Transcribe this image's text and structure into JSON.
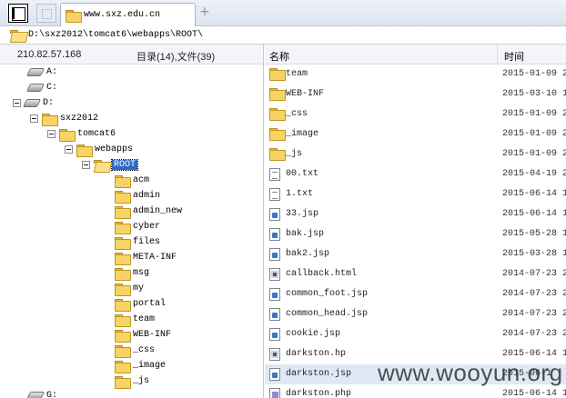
{
  "tabbar": {
    "tab_title": "www.sxz.edu.cn",
    "new_tab": "+"
  },
  "address": {
    "path": "D:\\sxz2012\\tomcat6\\webapps\\ROOT\\"
  },
  "left_header": {
    "ip": "210.82.57.168",
    "summary": "目录(14),文件(39)"
  },
  "tree": {
    "drive_a": "A:",
    "drive_c": "C:",
    "drive_d": "D:",
    "sxz2012": "sxz2012",
    "tomcat6": "tomcat6",
    "webapps": "webapps",
    "root": "ROOT",
    "children": [
      "acm",
      "admin",
      "admin_new",
      "cyber",
      "files",
      "META-INF",
      "msg",
      "my",
      "portal",
      "team",
      "WEB-INF",
      "_css",
      "_image",
      "_js"
    ],
    "drive_g": "G:"
  },
  "list_header": {
    "name": "名称",
    "time": "时间"
  },
  "files": [
    {
      "name": "team",
      "time": "2015-01-09 2",
      "icon": "folder-icon"
    },
    {
      "name": "WEB-INF",
      "time": "2015-03-10 1",
      "icon": "folder-icon"
    },
    {
      "name": "_css",
      "time": "2015-01-09 2",
      "icon": "folder-icon"
    },
    {
      "name": "_image",
      "time": "2015-01-09 2",
      "icon": "folder-icon"
    },
    {
      "name": "_js",
      "time": "2015-01-09 2",
      "icon": "folder-icon"
    },
    {
      "name": "00.txt",
      "time": "2015-04-19 2",
      "icon": "text-file-icon"
    },
    {
      "name": "1.txt",
      "time": "2015-06-14 1",
      "icon": "text-file-icon"
    },
    {
      "name": "33.jsp",
      "time": "2015-06-14 1",
      "icon": "jsp-file-icon"
    },
    {
      "name": "bak.jsp",
      "time": "2015-05-28 1",
      "icon": "jsp-file-icon"
    },
    {
      "name": "bak2.jsp",
      "time": "2015-03-28 1",
      "icon": "jsp-file-icon"
    },
    {
      "name": "callback.html",
      "time": "2014-07-23 2",
      "icon": "html-file-icon"
    },
    {
      "name": "common_foot.jsp",
      "time": "2014-07-23 2",
      "icon": "jsp-file-icon"
    },
    {
      "name": "common_head.jsp",
      "time": "2014-07-23 2",
      "icon": "jsp-file-icon"
    },
    {
      "name": "cookie.jsp",
      "time": "2014-07-23 2",
      "icon": "jsp-file-icon"
    },
    {
      "name": "darkston.hp",
      "time": "2015-06-14 1",
      "icon": "html-file-icon"
    },
    {
      "name": "darkston.jsp",
      "time": "2015-06-1",
      "icon": "jsp-file-icon"
    },
    {
      "name": "darkston.php",
      "time": "2015-06-14 1",
      "icon": "php-file-icon"
    }
  ],
  "highlighted_row": "darkston.jsp",
  "watermark": "www.wooyun.org"
}
